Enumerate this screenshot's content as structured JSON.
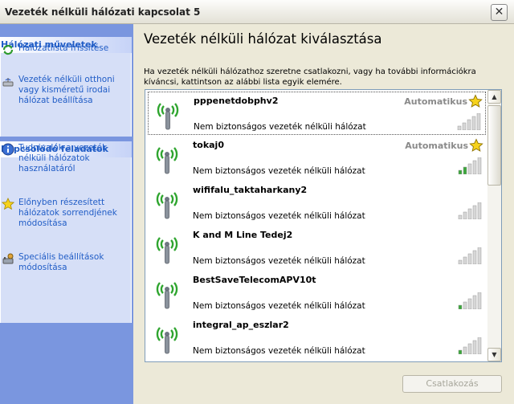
{
  "window": {
    "title": "Vezeték nélküli hálózati kapcsolat 5",
    "close_symbol": "✕"
  },
  "left_panel": {
    "network_tasks": {
      "header": "Hálózati műveletek",
      "items": [
        {
          "label": "Hálózatlista frissítése",
          "icon": "refresh-icon"
        },
        {
          "label": "Vezeték nélküli otthoni vagy kisméretű irodai hálózat beállítása",
          "icon": "wireless-setup-icon"
        }
      ]
    },
    "related_tasks": {
      "header": "Kapcsolódó feladatok",
      "items": [
        {
          "label": "Tudnivalók a vezeték nélküli hálózatok használatáról",
          "icon": "info-icon"
        },
        {
          "label": "Előnyben részesített hálózatok sorrendjének módosítása",
          "icon": "star-icon"
        },
        {
          "label": "Speciális beállítások módosítása",
          "icon": "settings-icon"
        }
      ]
    }
  },
  "main": {
    "title": "Vezeték nélküli hálózat kiválasztása",
    "description": "Ha vezeték nélküli hálózathoz szeretne csatlakozni, vagy ha további információkra kíváncsi, kattintson az alábbi lista egyik elemére.",
    "networks": [
      {
        "name": "pppenetdobphv2",
        "security": "Nem biztonságos vezeték nélküli hálózat",
        "auto": "Automatikus",
        "preferred": true,
        "signal_bars": 0,
        "selected": true
      },
      {
        "name": "tokaj0",
        "security": "Nem biztonságos vezeték nélküli hálózat",
        "auto": "Automatikus",
        "preferred": true,
        "signal_bars": 2,
        "selected": false
      },
      {
        "name": "wififalu_taktaharkany2",
        "security": "Nem biztonságos vezeték nélküli hálózat",
        "auto": "",
        "preferred": false,
        "signal_bars": 0,
        "selected": false
      },
      {
        "name": "K and M Line Tedej2",
        "security": "Nem biztonságos vezeték nélküli hálózat",
        "auto": "",
        "preferred": false,
        "signal_bars": 0,
        "selected": false
      },
      {
        "name": "BestSaveTelecomAPV10t",
        "security": "Nem biztonságos vezeték nélküli hálózat",
        "auto": "",
        "preferred": false,
        "signal_bars": 1,
        "selected": false
      },
      {
        "name": "integral_ap_eszlar2",
        "security": "Nem biztonságos vezeték nélküli hálózat",
        "auto": "",
        "preferred": false,
        "signal_bars": 1,
        "selected": false
      }
    ],
    "connect_button": "Csatlakozás"
  },
  "colors": {
    "signal_on": "#3aa63a",
    "signal_off": "#d7d7d7",
    "link_blue": "#215dc6",
    "auto_gray": "#8a8a8a"
  }
}
